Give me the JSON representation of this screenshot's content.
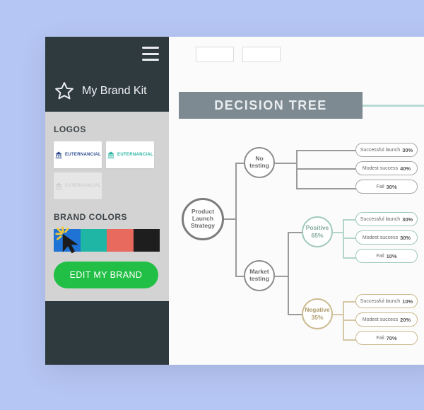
{
  "sidebar": {
    "title": "My Brand Kit",
    "logos_heading": "LOGOS",
    "colors_heading": "BRAND COLORS",
    "edit_button": "EDIT MY BRAND",
    "brand_colors": [
      "#1f73d4",
      "#1fb6a5",
      "#e86a5e",
      "#1e1e1e"
    ],
    "logos": [
      {
        "name": "EUTERNANCIAL",
        "accent": "#2a4a8e",
        "faded": false
      },
      {
        "name": "EUTERNANCIAL",
        "accent": "#26b2a2",
        "faded": false
      },
      {
        "name": "EUTERNANCIAL",
        "accent": "#c9c9c9",
        "faded": true
      }
    ]
  },
  "canvas": {
    "title": "DECISION TREE",
    "root": {
      "label": "Product Launch Strategy"
    },
    "no_testing": {
      "label": "No testing"
    },
    "market_testing": {
      "label": "Market testing"
    },
    "positive": {
      "label": "Positive",
      "pct": "65%"
    },
    "negative": {
      "label": "Negative",
      "pct": "35%"
    },
    "outcomes_grey": [
      {
        "label": "Successful launch",
        "pct": "30%"
      },
      {
        "label": "Modest success",
        "pct": "40%"
      },
      {
        "label": "Fail",
        "pct": "30%"
      }
    ],
    "outcomes_teal": [
      {
        "label": "Successful launch",
        "pct": "30%"
      },
      {
        "label": "Modest success",
        "pct": "30%"
      },
      {
        "label": "Fail",
        "pct": "10%"
      }
    ],
    "outcomes_gold": [
      {
        "label": "Successful launch",
        "pct": "10%"
      },
      {
        "label": "Modest success",
        "pct": "20%"
      },
      {
        "label": "Fail",
        "pct": "70%"
      }
    ]
  }
}
